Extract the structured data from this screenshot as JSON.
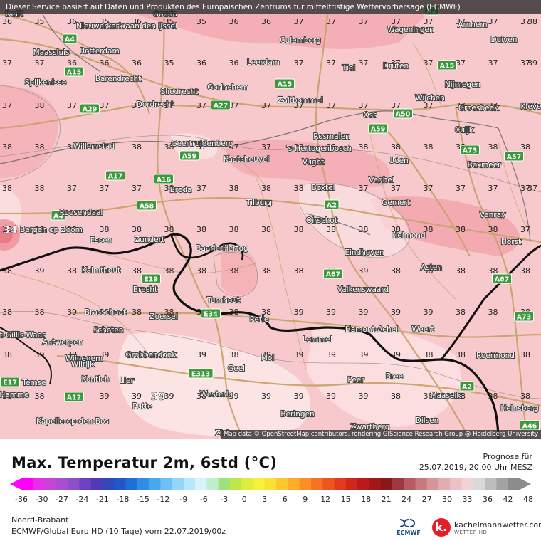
{
  "notice": "Dieser Service basiert auf Daten und Produkten des Europäischen Zentrums für mittelfristige Wettervorhersage (ECMWF)",
  "credit": "Map data © OpenStreetMap contributors, rendering GIScience Research Group @ Heidelberg University",
  "title": "Max. Temperatur 2m, 6std (°C)",
  "forecast_label": "Prognose für",
  "forecast_date": "25.07.2019, 20:00 Uhr MESZ",
  "region": "Noord-Brabant",
  "model": "ECMWF/Global Euro HD (10 Tage) vom 22.07.2019/00z",
  "ecmwf_logo": "ECMWF",
  "brand_name": "kachelmannwetter.com",
  "brand_sub": "WETTER HD",
  "brand_letter": "k.",
  "colorbar_ticks": [
    "-36",
    "-30",
    "-27",
    "-24",
    "-21",
    "-18",
    "-15",
    "-12",
    "-9",
    "-6",
    "-3",
    "0",
    "3",
    "6",
    "9",
    "12",
    "15",
    "18",
    "21",
    "24",
    "27",
    "30",
    "33",
    "36",
    "42",
    "48"
  ],
  "colors": {
    "map_base": "#f7c9cc",
    "warm_zone": "#f4a7ad",
    "cool_zone": "#fbe3e4",
    "roads": "#c9a46c",
    "border": "#111111"
  },
  "grid_rows": [
    [
      "36",
      "35",
      "36",
      "35",
      "36",
      "35",
      "35",
      "36",
      "36",
      "37",
      "37",
      "37",
      "37",
      "37",
      "37",
      "37",
      "37"
    ],
    [
      "37",
      "37",
      "36",
      "36",
      "36",
      "35",
      "36",
      "36",
      "37",
      "37",
      "37",
      "37",
      "37",
      "37",
      "37",
      "37",
      "37"
    ],
    [
      "37",
      "38",
      "37",
      "37",
      "36",
      "37",
      "37",
      "37",
      "37",
      "37",
      "37",
      "37",
      "37",
      "37",
      "37",
      "37",
      "37"
    ],
    [
      "38",
      "38",
      "38",
      "38",
      "38",
      "38",
      "37",
      "37",
      "37",
      "38",
      "38",
      "38",
      "38",
      "38",
      "38",
      "38",
      "38"
    ],
    [
      "38",
      "38",
      "37",
      "37",
      "37",
      "38",
      "37",
      "38",
      "38",
      "38",
      "38",
      "37",
      "37",
      "37",
      "37",
      "37",
      "37"
    ],
    [
      "38",
      "38",
      "38",
      "38",
      "38",
      "38",
      "38",
      "38",
      "38",
      "38",
      "38",
      "38",
      "38",
      "38",
      "38",
      "38",
      "37"
    ],
    [
      "38",
      "39",
      "38",
      "38",
      "38",
      "38",
      "38",
      "38",
      "38",
      "38",
      "38",
      "39",
      "38",
      "38",
      "38",
      "38",
      "38"
    ],
    [
      "38",
      "38",
      "39",
      "38",
      "38",
      "38",
      "38",
      "38",
      "38",
      "39",
      "39",
      "39",
      "39",
      "39",
      "38",
      "38",
      "38"
    ],
    [
      "38",
      "39",
      "38",
      "39",
      "39",
      "39",
      "39",
      "38",
      "39",
      "39",
      "39",
      "39",
      "39",
      "38",
      "38",
      "38",
      "38"
    ],
    [
      "38",
      "38",
      "39",
      "39",
      "39",
      "39",
      "38",
      "39",
      "39",
      "39",
      "39",
      "39",
      "38",
      "38",
      "38",
      "38",
      "38"
    ]
  ],
  "grid_extra": [
    "34",
    "39",
    "38",
    "39",
    "38",
    "37"
  ],
  "places": [
    {
      "name": "Delft"
    },
    {
      "name": "Gouda"
    },
    {
      "name": "Nieuwerkerk aan den IJssel"
    },
    {
      "name": "Wageningen"
    },
    {
      "name": "Arnhem"
    },
    {
      "name": "Maassluis"
    },
    {
      "name": "Rotterdam"
    },
    {
      "name": "Culemborg"
    },
    {
      "name": "Duiven"
    },
    {
      "name": "Leerdam"
    },
    {
      "name": "Tiel"
    },
    {
      "name": "Druten"
    },
    {
      "name": "Spijkenisse"
    },
    {
      "name": "Barendrecht"
    },
    {
      "name": "Sliedrecht"
    },
    {
      "name": "Gorinchem"
    },
    {
      "name": "Nijmegen"
    },
    {
      "name": "Zaltbommel"
    },
    {
      "name": "Wijchen"
    },
    {
      "name": "Dordrecht"
    },
    {
      "name": "Groesbeek"
    },
    {
      "name": "Oss"
    },
    {
      "name": "Kleve"
    },
    {
      "name": "Cuijk"
    },
    {
      "name": "Rosmalen"
    },
    {
      "name": "Geertruidenberg"
    },
    {
      "name": "'s-Hertogenbosch"
    },
    {
      "name": "Willemstad"
    },
    {
      "name": "Kaatsheuvel"
    },
    {
      "name": "Vught"
    },
    {
      "name": "Uden"
    },
    {
      "name": "Boxmeer"
    },
    {
      "name": "Veghel"
    },
    {
      "name": "Breda"
    },
    {
      "name": "Boxtel"
    },
    {
      "name": "Tilburg"
    },
    {
      "name": "Gemert"
    },
    {
      "name": "Roosendaal"
    },
    {
      "name": "Venray"
    },
    {
      "name": "Bergen op Zoom"
    },
    {
      "name": "Oirschot"
    },
    {
      "name": "Helmond"
    },
    {
      "name": "Essen"
    },
    {
      "name": "Zundert"
    },
    {
      "name": "Baarle-Hertog"
    },
    {
      "name": "Horst"
    },
    {
      "name": "Eindhoven"
    },
    {
      "name": "Asten"
    },
    {
      "name": "Kalmthout"
    },
    {
      "name": "Brecht"
    },
    {
      "name": "Valkenswaard"
    },
    {
      "name": "Turnhout"
    },
    {
      "name": "Brasschaat"
    },
    {
      "name": "Zoersel"
    },
    {
      "name": "Retie"
    },
    {
      "name": "Hamont-Achel"
    },
    {
      "name": "Weert"
    },
    {
      "name": "Schoten"
    },
    {
      "name": "Sint-Gillis-Waas"
    },
    {
      "name": "Lommel"
    },
    {
      "name": "Antwerpen"
    },
    {
      "name": "Wijnegem"
    },
    {
      "name": "Grobbendonk"
    },
    {
      "name": "Mol"
    },
    {
      "name": "Roermond"
    },
    {
      "name": "Wilrijk"
    },
    {
      "name": "Geel"
    },
    {
      "name": "Kontich"
    },
    {
      "name": "Lier"
    },
    {
      "name": "Peer"
    },
    {
      "name": "Bree"
    },
    {
      "name": "Temse"
    },
    {
      "name": "Hamme"
    },
    {
      "name": "Westerlo"
    },
    {
      "name": "Maaseik"
    },
    {
      "name": "Heinsberg"
    },
    {
      "name": "Putte"
    },
    {
      "name": "Kapelle-op-den-Bos"
    },
    {
      "name": "Beringen"
    },
    {
      "name": "Dilsen"
    },
    {
      "name": "Zwartberg"
    },
    {
      "name": "Zichem"
    }
  ],
  "road_shields": [
    {
      "label": "A4"
    },
    {
      "label": "A15"
    },
    {
      "label": "A2"
    },
    {
      "label": "A15"
    },
    {
      "label": "A29"
    },
    {
      "label": "A27"
    },
    {
      "label": "A15"
    },
    {
      "label": "A50"
    },
    {
      "label": "A59"
    },
    {
      "label": "A73"
    },
    {
      "label": "A57"
    },
    {
      "label": "A59"
    },
    {
      "label": "A17"
    },
    {
      "label": "A16"
    },
    {
      "label": "A2"
    },
    {
      "label": "A4"
    },
    {
      "label": "A58"
    },
    {
      "label": "A67"
    },
    {
      "label": "A67"
    },
    {
      "label": "E19"
    },
    {
      "label": "A73"
    },
    {
      "label": "E34"
    },
    {
      "label": "E313"
    },
    {
      "label": "E17"
    },
    {
      "label": "A12"
    },
    {
      "label": "A2"
    },
    {
      "label": "A46"
    }
  ]
}
